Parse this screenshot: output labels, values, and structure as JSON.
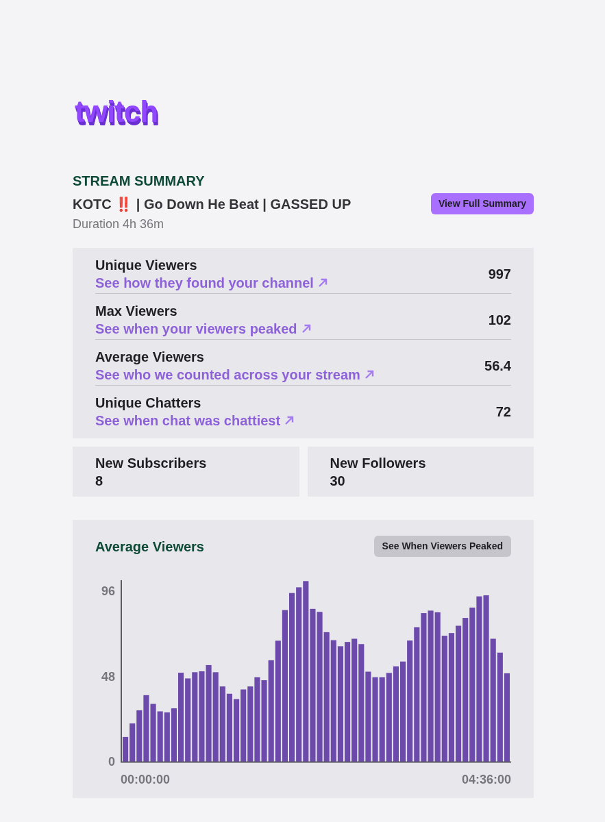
{
  "logo": "twitch",
  "summary": {
    "heading": "STREAM SUMMARY",
    "title_parts": [
      {
        "kind": "text",
        "text": "KOTC "
      },
      {
        "kind": "emoji",
        "text": "‼️"
      },
      {
        "kind": "text",
        "text": " | Go Down He Beat | GASSED UP"
      }
    ],
    "button": "View Full Summary",
    "duration": "Duration 4h 36m"
  },
  "stats": [
    {
      "label": "Unique Viewers",
      "link": "See how they found your channel",
      "value": "997"
    },
    {
      "label": "Max Viewers",
      "link": "See when your viewers peaked",
      "value": "102"
    },
    {
      "label": "Average Viewers",
      "link": "See who we counted across your stream",
      "value": "56.4"
    },
    {
      "label": "Unique Chatters",
      "link": "See when chat was chattiest",
      "value": "72"
    }
  ],
  "counters": [
    {
      "label": "New Subscribers",
      "value": "8"
    },
    {
      "label": "New Followers",
      "value": "30"
    }
  ],
  "chart_card": {
    "title": "Average Viewers",
    "button": "See When Viewers Peaked",
    "axis_labels": [
      "00:00:00",
      "04:36:00"
    ],
    "chart_data": {
      "type": "bar",
      "values": [
        13.9,
        21.5,
        28.9,
        37.4,
        32.5,
        28.3,
        27.7,
        30,
        50,
        46.8,
        50.3,
        50.8,
        54.3,
        50.3,
        42.3,
        38.2,
        35.2,
        40.6,
        42.3,
        47.5,
        45.8,
        57,
        68,
        85.2,
        94.8,
        98,
        101.5,
        85.9,
        84.2,
        72.8,
        68.3,
        64.9,
        67.3,
        69.1,
        66.1,
        50.6,
        47.5,
        47.5,
        49.9,
        53.6,
        56.3,
        68.1,
        75.6,
        83.5,
        84.9,
        84,
        70.8,
        72.3,
        76.4,
        80.8,
        86.6,
        92.9,
        93.5,
        69.1,
        61.3,
        49.7
      ],
      "ylim": [
        0,
        102
      ],
      "yticks": [
        0,
        48,
        96
      ]
    }
  }
}
